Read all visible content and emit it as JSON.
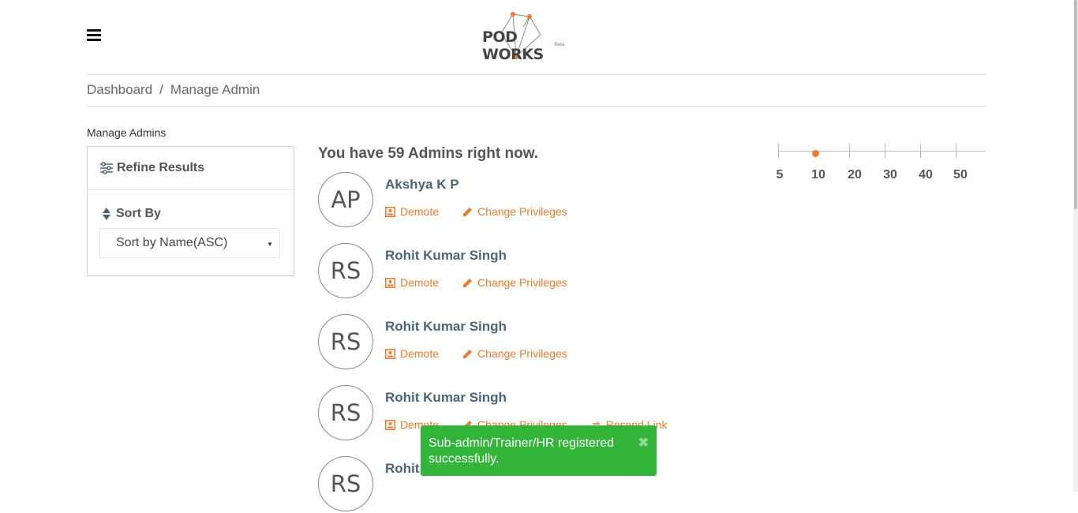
{
  "header": {
    "logo_text": "POD WORKS",
    "logo_sub": "Beta",
    "menu_icon": "hamburger-menu-icon"
  },
  "breadcrumb": {
    "items": [
      "Dashboard",
      "Manage Admin"
    ],
    "separator": "/"
  },
  "sidebar": {
    "title": "Manage Admins",
    "refine_label": "Refine Results",
    "sort_label": "Sort By",
    "sort_value": "Sort by Name(ASC)"
  },
  "main": {
    "heading": "You have 59 Admins right now.",
    "admins": [
      {
        "initials": "AP",
        "name": "Akshya K P",
        "actions": [
          "Demote",
          "Change Privileges"
        ]
      },
      {
        "initials": "RS",
        "name": "Rohit Kumar Singh",
        "actions": [
          "Demote",
          "Change Privileges"
        ]
      },
      {
        "initials": "RS",
        "name": "Rohit Kumar Singh",
        "actions": [
          "Demote",
          "Change Privileges"
        ]
      },
      {
        "initials": "RS",
        "name": "Rohit Kumar Singh",
        "actions": [
          "Demote",
          "Change Privileges",
          "Resend Link"
        ]
      },
      {
        "initials": "RS",
        "name": "Rohit Kumar Singh",
        "actions": []
      }
    ]
  },
  "page_size_slider": {
    "options": [
      "5",
      "10",
      "20",
      "30",
      "40",
      "50"
    ],
    "selected": "10"
  },
  "toast": {
    "message": "Sub-admin/Trainer/HR registered successfully.",
    "close_icon": "close-icon"
  },
  "colors": {
    "accent": "#ef7a2b",
    "name": "#4a6478",
    "toast": "#33b53a"
  }
}
